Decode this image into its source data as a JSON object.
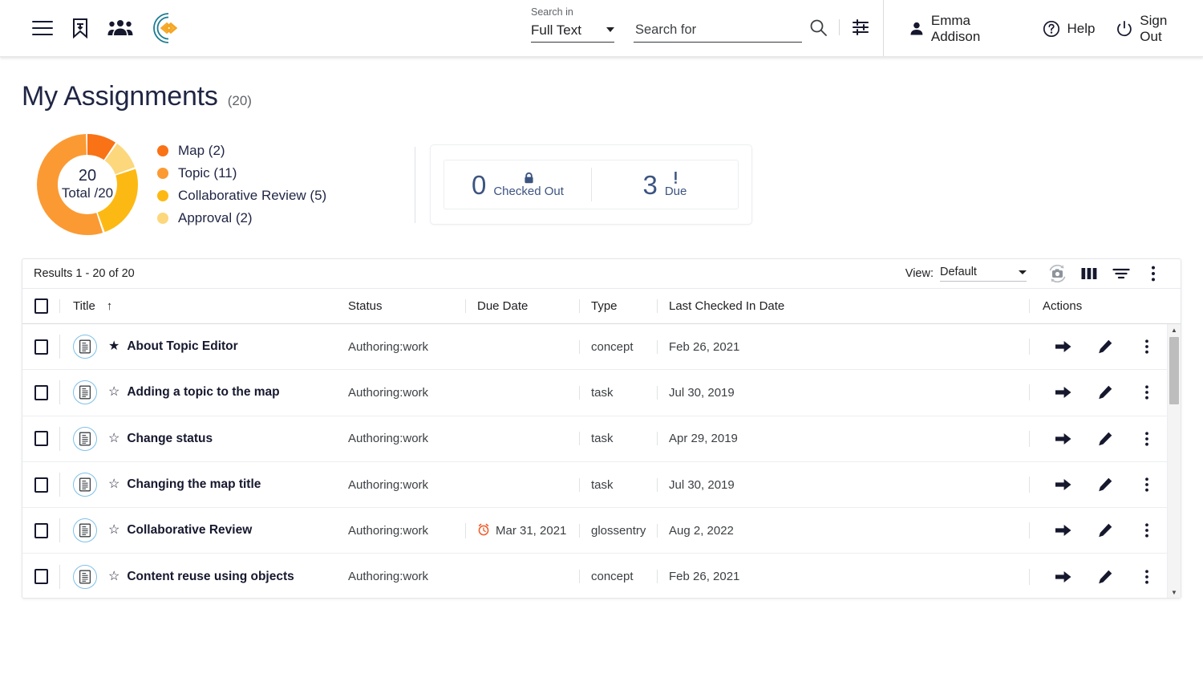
{
  "header": {
    "menu_icon": "hamburger-menu-icon",
    "bookmark_icon": "bookmark-icon",
    "people_icon": "people-group-icon",
    "logo_icon": "brand-logo-icon",
    "search_in_label": "Search in",
    "search_in_value": "Full Text",
    "search_in_options": [
      "Full Text"
    ],
    "search_placeholder": "Search for",
    "search_value": "",
    "search_icon": "search-icon",
    "filter_settings_icon": "search-settings-icon",
    "user_name": "Emma Addison",
    "user_icon": "person-icon",
    "help_label": "Help",
    "help_icon": "question-circle-icon",
    "signout_label": "Sign Out",
    "signout_icon": "power-icon"
  },
  "page": {
    "title": "My Assignments",
    "count": "(20)"
  },
  "chart_data": {
    "type": "pie",
    "title": "My Assignments",
    "center_value": "20",
    "center_label": "Total /20",
    "total": 20,
    "categories": [
      "Map",
      "Topic",
      "Collaborative Review",
      "Approval"
    ],
    "values": [
      2,
      11,
      5,
      2
    ],
    "labels": [
      "Map (2)",
      "Topic (11)",
      "Collaborative Review (5)",
      "Approval (2)"
    ],
    "colors": [
      "#f97215",
      "#fb9a33",
      "#fdb913",
      "#fcd77c"
    ],
    "legend_position": "right",
    "grid": false
  },
  "stats": [
    {
      "value": "0",
      "label": "Checked Out",
      "icon": "lock-icon"
    },
    {
      "value": "3",
      "label": "Due",
      "icon": "exclamation-icon"
    }
  ],
  "table": {
    "results_text": "Results 1 - 20 of 20",
    "view_label": "View:",
    "view_value": "Default",
    "view_options": [
      "Default"
    ],
    "toolbar_icons": [
      "snapshot-refresh-icon",
      "columns-icon",
      "filter-icon",
      "more-vertical-icon"
    ],
    "columns": [
      "Title",
      "Status",
      "Due Date",
      "Type",
      "Last Checked In Date",
      "",
      "Actions"
    ],
    "sort_column": "Title",
    "sort_direction": "ascending",
    "sort_icon": "arrow-up-icon",
    "select_all_icon": "checkbox-unchecked-icon",
    "row_action_icons": [
      "arrow-right-icon",
      "pencil-edit-icon",
      "more-vertical-icon"
    ],
    "rows": [
      {
        "doc_icon": "document-icon",
        "favorite": true,
        "favorite_icon": "star-filled-icon",
        "title": "About Topic Editor",
        "status": "Authoring:work",
        "due_date": "",
        "due_overdue": false,
        "type": "concept",
        "last_checked_in": "Feb 26, 2021"
      },
      {
        "doc_icon": "document-icon",
        "favorite": false,
        "favorite_icon": "star-outline-icon",
        "title": "Adding a topic to the map",
        "status": "Authoring:work",
        "due_date": "",
        "due_overdue": false,
        "type": "task",
        "last_checked_in": "Jul 30, 2019"
      },
      {
        "doc_icon": "document-icon",
        "favorite": false,
        "favorite_icon": "star-outline-icon",
        "title": "Change status",
        "status": "Authoring:work",
        "due_date": "",
        "due_overdue": false,
        "type": "task",
        "last_checked_in": "Apr 29, 2019"
      },
      {
        "doc_icon": "document-icon",
        "favorite": false,
        "favorite_icon": "star-outline-icon",
        "title": "Changing the map title",
        "status": "Authoring:work",
        "due_date": "",
        "due_overdue": false,
        "type": "task",
        "last_checked_in": "Jul 30, 2019"
      },
      {
        "doc_icon": "document-icon",
        "favorite": false,
        "favorite_icon": "star-outline-icon",
        "title": "Collaborative Review",
        "status": "Authoring:work",
        "due_date": "Mar 31, 2021",
        "due_overdue": true,
        "due_icon": "alarm-clock-icon",
        "type": "glossentry",
        "last_checked_in": "Aug 2, 2022"
      },
      {
        "doc_icon": "document-icon",
        "favorite": false,
        "favorite_icon": "star-outline-icon",
        "title": "Content reuse using objects",
        "status": "Authoring:work",
        "due_date": "",
        "due_overdue": false,
        "type": "concept",
        "last_checked_in": "Feb 26, 2021"
      }
    ]
  },
  "colors": {
    "brand_teal": "#1c7c92",
    "brand_orange": "#f5a623",
    "accent_blue": "#3c5480",
    "overdue_red": "#ef5c28",
    "doc_badge_border": "#7ec0e8"
  }
}
